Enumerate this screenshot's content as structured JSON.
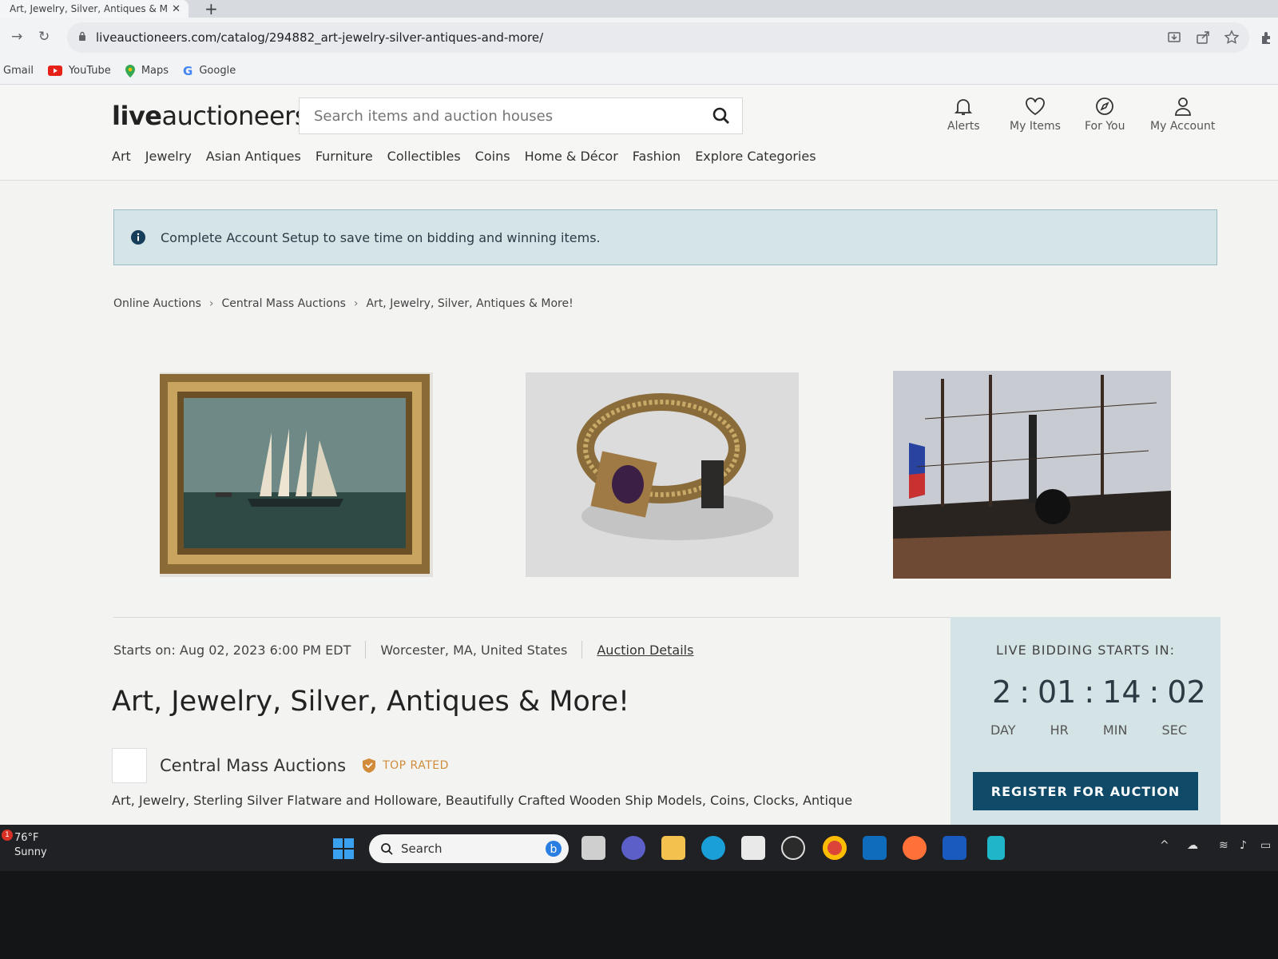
{
  "browser": {
    "tab_title": "Art, Jewelry, Silver, Antiques & M",
    "url": "liveauctioneers.com/catalog/294882_art-jewelry-silver-antiques-and-more/",
    "bookmarks": [
      {
        "label": "Gmail",
        "icon": "gmail-icon"
      },
      {
        "label": "YouTube",
        "icon": "youtube-icon"
      },
      {
        "label": "Maps",
        "icon": "maps-icon"
      },
      {
        "label": "Google",
        "icon": "google-icon"
      }
    ]
  },
  "site": {
    "logo_bold": "live",
    "logo_light": "auctioneers",
    "search_placeholder": "Search items and auction houses",
    "header_icons": [
      {
        "label": "Alerts",
        "icon": "bell-icon"
      },
      {
        "label": "My Items",
        "icon": "heart-icon"
      },
      {
        "label": "For You",
        "icon": "compass-icon"
      },
      {
        "label": "My Account",
        "icon": "user-icon"
      }
    ],
    "categories": [
      "Art",
      "Jewelry",
      "Asian Antiques",
      "Furniture",
      "Collectibles",
      "Coins",
      "Home & Décor",
      "Fashion",
      "Explore Categories"
    ]
  },
  "alert": {
    "link_text": "Complete Account Setup",
    "rest_text": " to save time on bidding and winning items."
  },
  "breadcrumb": [
    "Online Auctions",
    "Central Mass Auctions",
    "Art, Jewelry, Silver, Antiques & More!"
  ],
  "photos": [
    {
      "alt": "Framed painting of a sailing schooner"
    },
    {
      "alt": "Gold bracelet with amethyst clasp"
    },
    {
      "alt": "Wooden ship model"
    }
  ],
  "auction": {
    "starts": "Starts on: Aug 02, 2023 6:00 PM EDT",
    "location": "Worcester, MA, United States",
    "details_link": "Auction Details",
    "title": "Art, Jewelry, Silver, Antiques & More!",
    "house_name": "Central Mass Auctions",
    "badge": "TOP RATED",
    "description": "Art, Jewelry, Sterling Silver Flatware and Holloware, Beautifully Crafted Wooden Ship Models, Coins, Clocks, Antique"
  },
  "countdown": {
    "heading": "LIVE BIDDING STARTS IN:",
    "day": "2",
    "hr": "01",
    "min": "14",
    "sec": "02",
    "labels": [
      "DAY",
      "HR",
      "MIN",
      "SEC"
    ],
    "button": "REGISTER FOR AUCTION"
  },
  "taskbar": {
    "weather_temp": "76°F",
    "weather_desc": "Sunny",
    "notification_count": "1",
    "search_label": "Search"
  },
  "colors": {
    "accent": "#0f4a68",
    "alert_bg": "#d5e4e6",
    "top_rated": "#d18b3b"
  }
}
